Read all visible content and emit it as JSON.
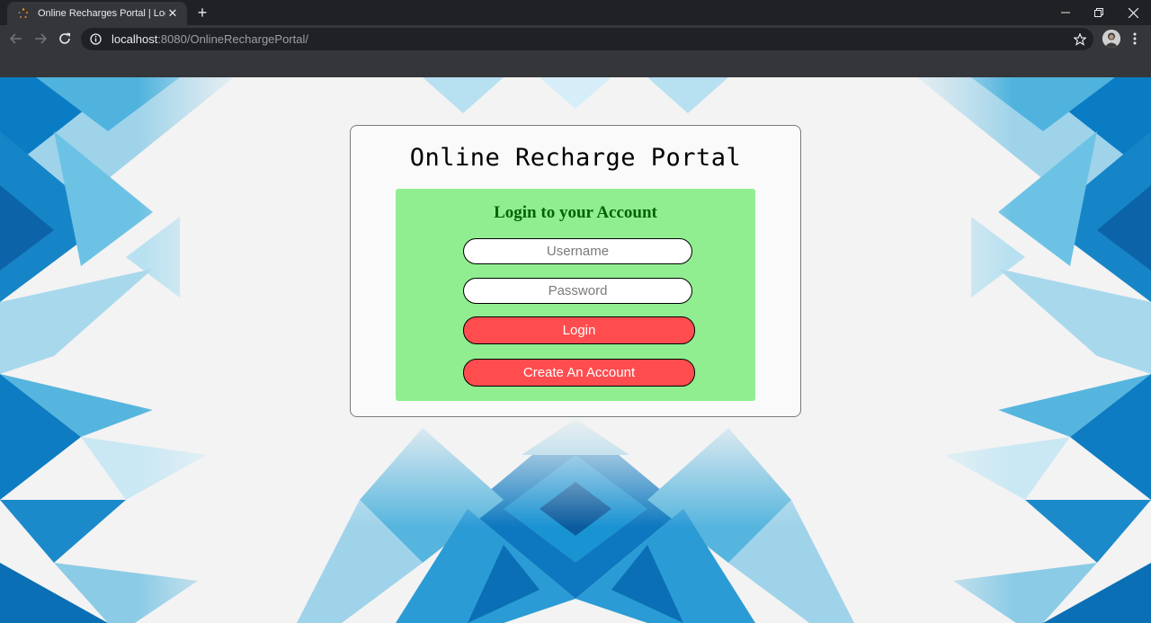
{
  "browser": {
    "tab_title": "Online Recharges Portal | Login",
    "url_host": "localhost",
    "url_rest": ":8080/OnlineRechargePortal/"
  },
  "icons": {
    "tab_favicon": "loading-spinner-icon",
    "tab_close": "close-icon",
    "new_tab": "plus-icon",
    "minimize": "minimize-icon",
    "restore": "restore-icon",
    "close_window": "close-icon",
    "back": "back-arrow-icon",
    "forward": "forward-arrow-icon",
    "reload": "reload-icon",
    "site_info": "info-icon",
    "bookmark": "star-icon",
    "profile": "avatar",
    "menu": "kebab-menu-icon"
  },
  "page": {
    "title": "Online Recharge Portal",
    "form": {
      "heading": "Login to your Account",
      "username_placeholder": "Username",
      "password_placeholder": "Password",
      "login_label": "Login",
      "create_account_label": "Create An Account"
    }
  },
  "colors": {
    "panel_green": "#90ee90",
    "heading_green": "#006400",
    "button_red": "#ff4d4f",
    "pattern_blue": "#0a7cc4"
  }
}
